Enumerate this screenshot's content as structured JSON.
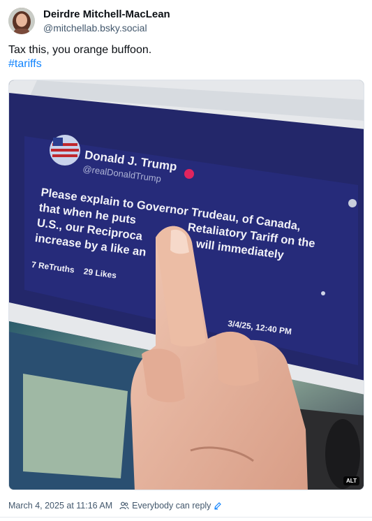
{
  "author": {
    "display_name": "Deirdre Mitchell-MacLean",
    "handle": "@mitchellab.bsky.social"
  },
  "post": {
    "text": "Tax this, you orange buffoon.",
    "hashtag": "#tariffs"
  },
  "image": {
    "alt_badge": "ALT",
    "screen_post": {
      "name": "Donald J. Trump",
      "handle": "@realDonaldTrump",
      "body_line1": "Please explain to Governor Trudeau, of Canada,",
      "body_line2": "that when he puts",
      "body_line2b": "Retaliatory Tariff on the",
      "body_line3": "U.S., our Reciproca",
      "body_line3b": "will immediately",
      "body_line4": "increase by a like an",
      "retruths_count": "7",
      "retruths_label": "ReTruths",
      "likes_count": "29",
      "likes_label": "Likes",
      "timestamp": "3/4/25, 12:40 PM"
    }
  },
  "footer": {
    "timestamp": "March 4, 2025 at 11:16 AM",
    "reply_setting": "Everybody can reply"
  },
  "colors": {
    "link": "#1083fe",
    "muted": "#42576c"
  }
}
